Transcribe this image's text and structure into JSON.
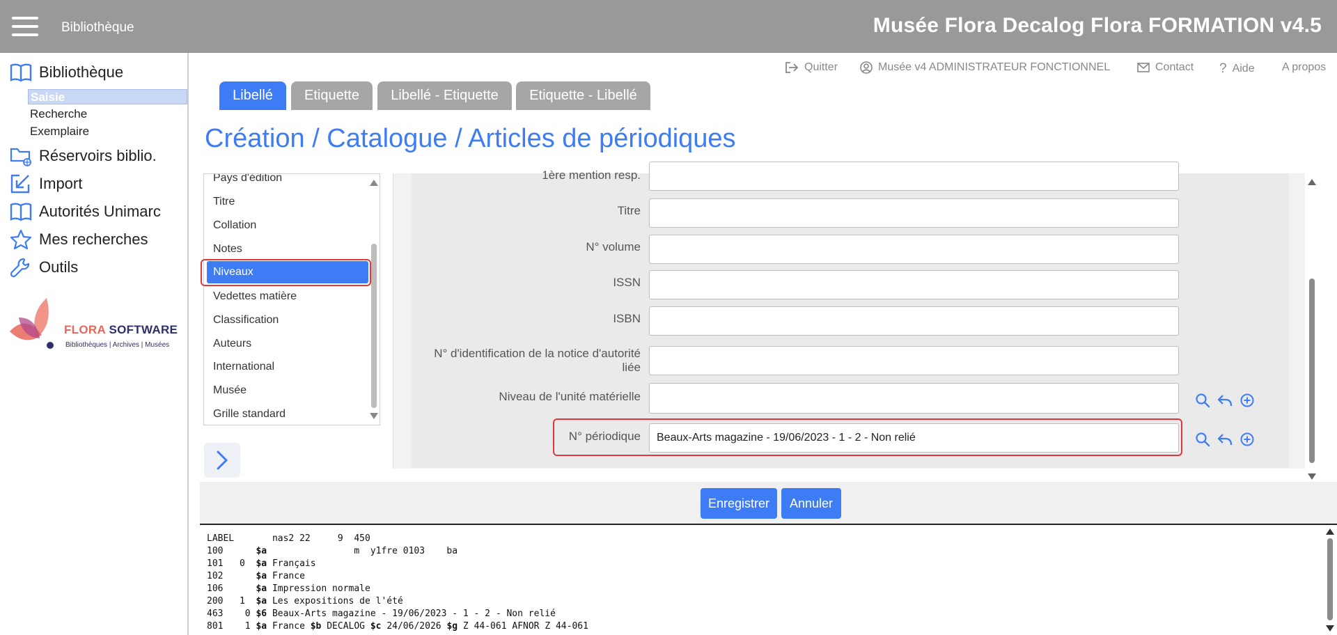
{
  "topbar": {
    "app_label": "Bibliothèque",
    "title": "Musée Flora Decalog Flora FORMATION v4.5"
  },
  "sidebar": {
    "sections": [
      {
        "label": "Bibliothèque",
        "icon": "book-icon"
      },
      {
        "label": "Réservoirs biblio.",
        "icon": "folder-globe-icon"
      },
      {
        "label": "Import",
        "icon": "import-icon"
      },
      {
        "label": "Autorités Unimarc",
        "icon": "book-icon"
      },
      {
        "label": "Mes recherches",
        "icon": "star-icon"
      },
      {
        "label": "Outils",
        "icon": "wrench-icon"
      }
    ],
    "subitems": [
      "Saisie",
      "Recherche",
      "Exemplaire"
    ],
    "active_subitem": "Saisie"
  },
  "logo": {
    "brand_part1": "FLORA",
    "brand_part2": "SOFTWARE",
    "tagline": "Bibliothèques | Archives | Musées"
  },
  "util_links": {
    "quit": "Quitter",
    "user": "Musée v4 ADMINISTRATEUR FONCTIONNEL",
    "contact": "Contact",
    "help": "Aide",
    "about": "A propos"
  },
  "tabs": [
    "Libellé",
    "Etiquette",
    "Libellé - Etiquette",
    "Etiquette - Libellé"
  ],
  "active_tab": "Libellé",
  "page_title": "Création / Catalogue / Articles de périodiques",
  "section_list": {
    "items": [
      "Pays d'édition",
      "Titre",
      "Collation",
      "Notes",
      "Niveaux",
      "Vedettes matière",
      "Classification",
      "Auteurs",
      "International",
      "Musée",
      "Grille standard"
    ],
    "active": "Niveaux"
  },
  "form": {
    "fields": [
      {
        "label": "1ère mention resp.",
        "value": ""
      },
      {
        "label": "Titre",
        "value": ""
      },
      {
        "label": "N° volume",
        "value": ""
      },
      {
        "label": "ISSN",
        "value": ""
      },
      {
        "label": "ISBN",
        "value": ""
      },
      {
        "label_line1": "N° d'identification de la notice d'autorité",
        "label_line2": "liée",
        "value": ""
      },
      {
        "label": "Niveau de l'unité matérielle",
        "value": ""
      },
      {
        "label": "N° périodique",
        "value": "Beaux-Arts magazine - 19/06/2023 - 1 - 2 - Non relié"
      }
    ]
  },
  "buttons": {
    "save": "Enregistrer",
    "cancel": "Annuler"
  },
  "marc": {
    "lines": [
      {
        "tag": "LABEL",
        "ind": "",
        "code": "",
        "text": "nas2 22     9  450"
      },
      {
        "tag": "100",
        "ind": "",
        "code": "$a",
        "text": "                m  y1fre 0103    ba"
      },
      {
        "tag": "101",
        "ind": "0",
        "code": "$a",
        "text": "Français"
      },
      {
        "tag": "102",
        "ind": "",
        "code": "$a",
        "text": "France"
      },
      {
        "tag": "106",
        "ind": "",
        "code": "$a",
        "text": "Impression normale"
      },
      {
        "tag": "200",
        "ind": "1",
        "code": "$a",
        "text": "Les expositions de l'été"
      },
      {
        "tag": "463",
        "ind": "0",
        "code": "$6",
        "text": "Beaux-Arts magazine - 19/06/2023 - 1 - 2 - Non relié"
      },
      {
        "tag": "801",
        "ind": "1",
        "code": "$a",
        "text": "France",
        "b": "DECALOG",
        "c": "24/06/2026",
        "g": "Z 44-061 AFNOR Z 44-061"
      }
    ]
  },
  "colors": {
    "accent": "#3d7cf5",
    "topbar": "#999999",
    "highlight": "#e0383a"
  }
}
